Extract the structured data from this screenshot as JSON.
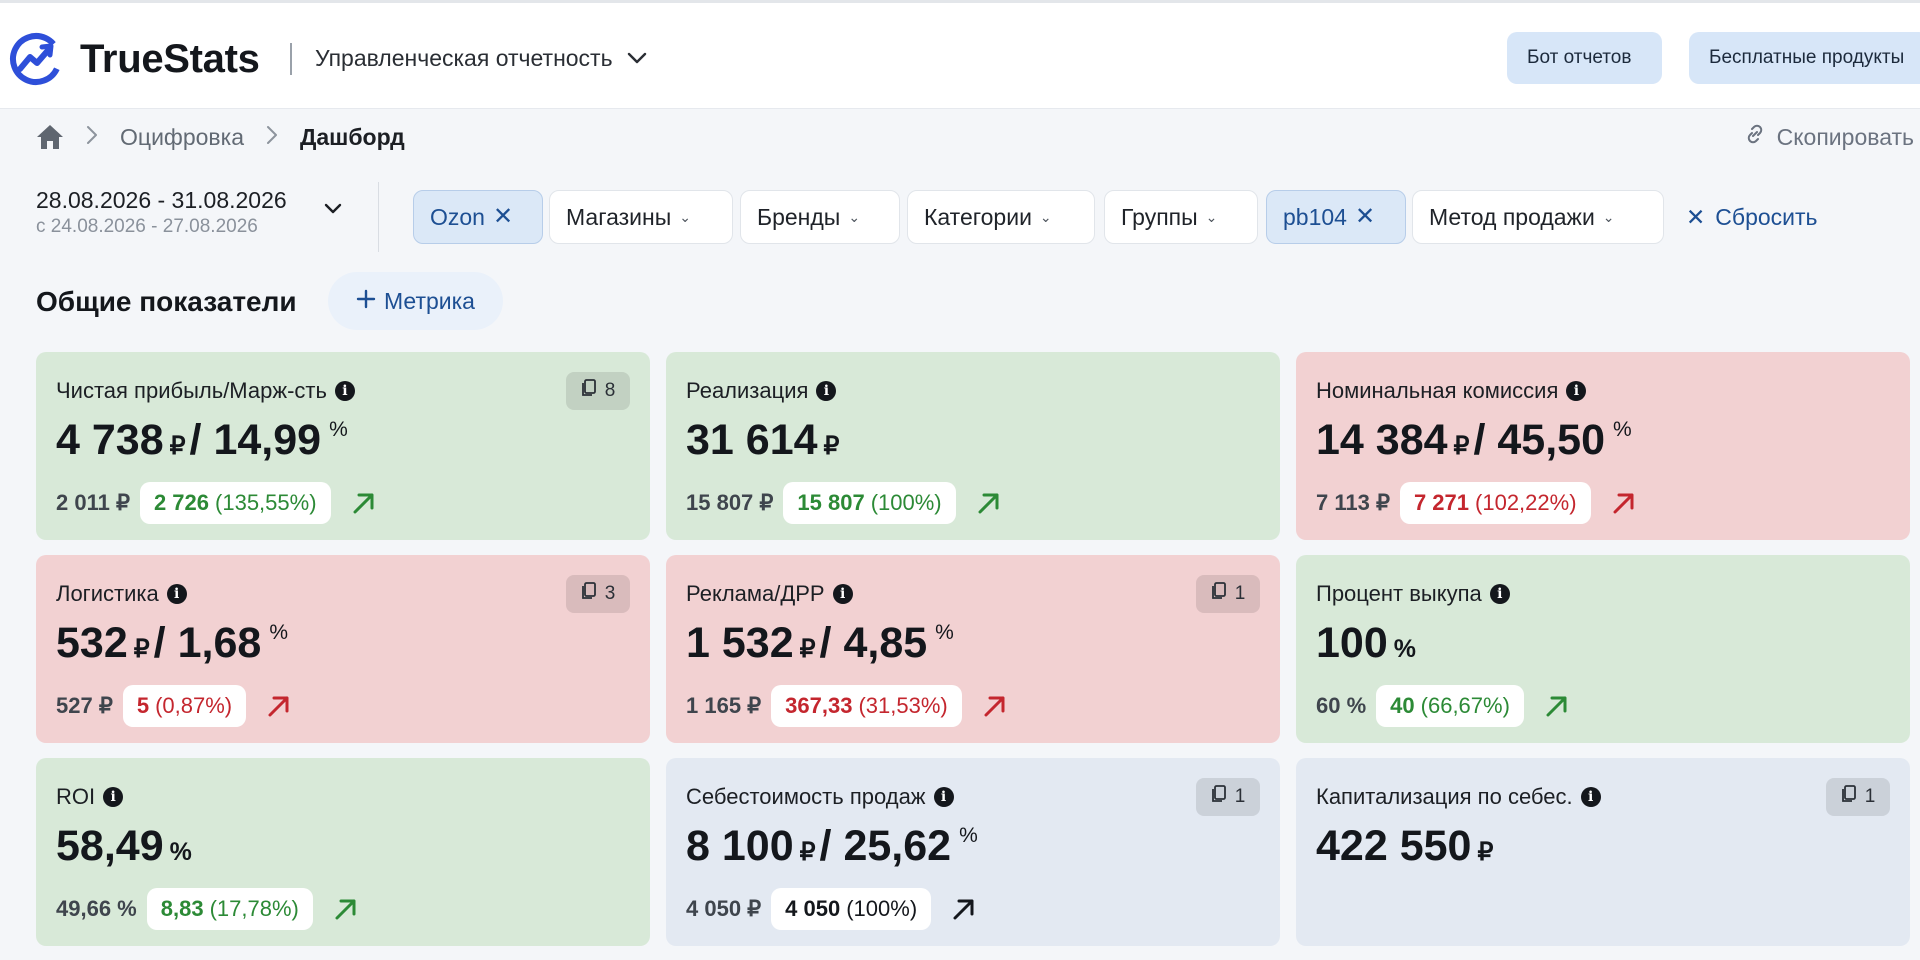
{
  "app": {
    "brand": "TrueStats",
    "section": "Управленческая отчетность",
    "buttons": {
      "bot": "Бот отчетов",
      "free": "Бесплатные продукты"
    },
    "accent": "#2e4fd9"
  },
  "breadcrumb": {
    "items": [
      "Оцифровка"
    ],
    "current": "Дашборд",
    "copy": "Скопировать"
  },
  "filters": {
    "date_main": "28.08.2026 - 31.08.2026",
    "date_compare": "с 24.08.2026 - 27.08.2026",
    "chips": [
      {
        "label": "Ozon",
        "active": true
      },
      {
        "label": "Магазины",
        "active": false
      },
      {
        "label": "Бренды",
        "active": false
      },
      {
        "label": "Категории",
        "active": false
      },
      {
        "label": "Группы",
        "active": false
      },
      {
        "label": "pb104",
        "active": true
      },
      {
        "label": "Метод продажи",
        "active": false
      }
    ],
    "reset": "Сбросить"
  },
  "overview": {
    "title": "Общие показатели",
    "add_metric": "Метрика"
  },
  "cards": [
    {
      "title": "Чистая прибыль/Марж-сть",
      "badge": "8",
      "value": "4 738",
      "currency": "₽",
      "percent": "14,99",
      "prev": "2 011 ₽",
      "delta": "2 726",
      "delta_pct": "(135,55%)",
      "tone": "green",
      "trend": "pos"
    },
    {
      "title": "Реализация",
      "badge": "",
      "value": "31 614",
      "currency": "₽",
      "percent": "",
      "prev": "15 807 ₽",
      "delta": "15 807",
      "delta_pct": "(100%)",
      "tone": "green",
      "trend": "pos"
    },
    {
      "title": "Номинальная комиссия",
      "badge": "",
      "value": "14 384",
      "currency": "₽",
      "percent": "45,50",
      "prev": "7 113 ₽",
      "delta": "7 271",
      "delta_pct": "(102,22%)",
      "tone": "red",
      "trend": "neg"
    },
    {
      "title": "Логистика",
      "badge": "3",
      "value": "532",
      "currency": "₽",
      "percent": "1,68",
      "prev": "527 ₽",
      "delta": "5",
      "delta_pct": "(0,87%)",
      "tone": "red",
      "trend": "neg"
    },
    {
      "title": "Реклама/ДРР",
      "badge": "1",
      "value": "1 532",
      "currency": "₽",
      "percent": "4,85",
      "prev": "1 165 ₽",
      "delta": "367,33",
      "delta_pct": "(31,53%)",
      "tone": "red",
      "trend": "neg"
    },
    {
      "title": "Процент выкупа",
      "badge": "",
      "value": "100",
      "currency": "",
      "percent": "",
      "unit": "%",
      "prev": "60 %",
      "delta": "40",
      "delta_pct": "(66,67%)",
      "tone": "green",
      "trend": "pos"
    },
    {
      "title": "ROI",
      "badge": "",
      "value": "58,49",
      "currency": "",
      "percent": "",
      "unit": "%",
      "prev": "49,66 %",
      "delta": "8,83",
      "delta_pct": "(17,78%)",
      "tone": "green",
      "trend": "pos"
    },
    {
      "title": "Себестоимость продаж",
      "badge": "1",
      "value": "8 100",
      "currency": "₽",
      "percent": "25,62",
      "prev": "4 050 ₽",
      "delta": "4 050",
      "delta_pct": "(100%)",
      "tone": "blue",
      "trend": "neu"
    },
    {
      "title": "Капитализация по себес.",
      "badge": "1",
      "value": "422 550",
      "currency": "₽",
      "percent": "",
      "prev": "",
      "delta": "",
      "delta_pct": "",
      "tone": "blue",
      "trend": "none"
    }
  ],
  "colors": {
    "positive": "#2c8a36",
    "negative": "#c4262e",
    "card_green": "#d8e9d8",
    "card_red": "#f2d1d2",
    "card_blue": "#e3e9f2"
  },
  "icons": [
    "truestats-logo-icon",
    "chevron-down-icon",
    "home-icon",
    "chevron-right-icon",
    "link-icon",
    "close-icon",
    "plus-icon",
    "info-icon",
    "document-icon",
    "arrow-up-right-icon"
  ]
}
